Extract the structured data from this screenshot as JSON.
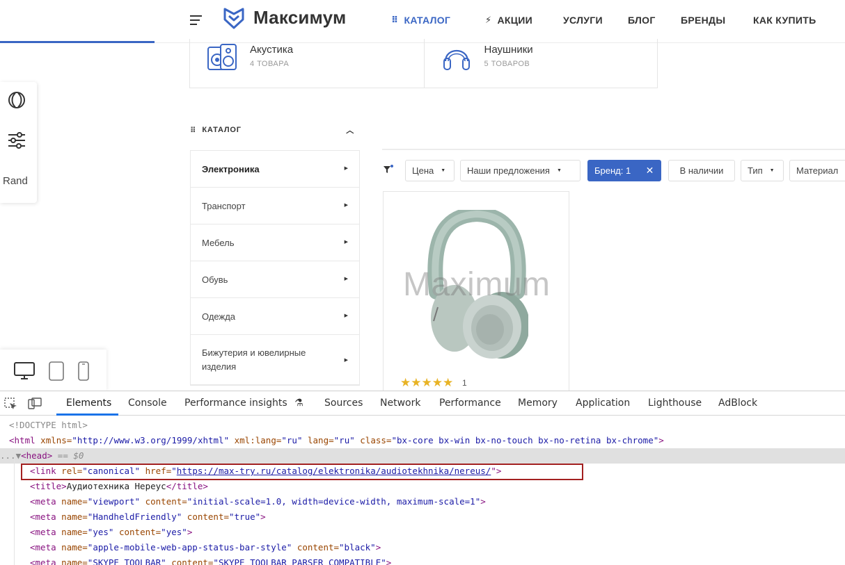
{
  "header": {
    "logo_text": "Максимум",
    "nav": [
      {
        "label": "КАТАЛОГ",
        "icon": "grid-dots-icon",
        "active": true
      },
      {
        "label": "АКЦИИ",
        "icon": "lightning-icon",
        "active": false
      },
      {
        "label": "УСЛУГИ",
        "icon": "",
        "active": false
      },
      {
        "label": "БЛОГ",
        "icon": "",
        "active": false
      },
      {
        "label": "БРЕНДЫ",
        "icon": "",
        "active": false
      },
      {
        "label": "КАК КУПИТЬ",
        "icon": "",
        "active": false
      }
    ],
    "accent_color": "#3a66c4"
  },
  "category_strip": [
    {
      "name": "Акустика",
      "count": "4 ТОВАРА",
      "icon": "speaker-icon"
    },
    {
      "name": "Наушники",
      "count": "5 ТОВАРОВ",
      "icon": "headphones-icon"
    }
  ],
  "float_panel": {
    "label": "Rand"
  },
  "catalog": {
    "heading": "КАТАЛОГ",
    "items": [
      {
        "label": "Электроника",
        "active": true
      },
      {
        "label": "Транспорт",
        "active": false
      },
      {
        "label": "Мебель",
        "active": false
      },
      {
        "label": "Обувь",
        "active": false
      },
      {
        "label": "Одежда",
        "active": false
      },
      {
        "label": "Бижутерия и ювелирные изделия",
        "active": false
      }
    ]
  },
  "filters": {
    "price": "Цена",
    "offers": "Наши предложения",
    "brand": "Бренд: 1",
    "brand_clear": "✕",
    "in_stock": "В наличии",
    "type": "Тип",
    "material": "Материал"
  },
  "product": {
    "watermark": "Maximum",
    "stars": "★★★★★",
    "rating_count": "1"
  },
  "devtools": {
    "tabs": [
      "Elements",
      "Console",
      "Performance insights",
      "Sources",
      "Network",
      "Performance",
      "Memory",
      "Application",
      "Lighthouse",
      "AdBlock"
    ],
    "active_tab": "Elements",
    "code": {
      "doctype": "<!DOCTYPE html>",
      "html_open": "<html",
      "html_xmlns_attr": " xmlns=",
      "html_xmlns_val": "\"http://www.w3.org/1999/xhtml\"",
      "html_xmllang_attr": " xml:lang=",
      "html_xmllang_val": "\"ru\"",
      "html_lang_attr": " lang=",
      "html_lang_val": "\"ru\"",
      "html_class_attr": " class=",
      "html_class_val": "\"bx-core bx-win bx-no-touch bx-no-retina bx-chrome\"",
      "html_close": ">",
      "ellipsis": "...",
      "head_tag": "<head>",
      "head_eq": " == $0",
      "link_open": "<link",
      "link_rel_attr": " rel=",
      "link_rel_val": "\"canonical\"",
      "link_href_attr": " href=",
      "link_href_q": "\"",
      "link_href_val": "https://max-try.ru/catalog/elektronika/audiotekhnika/nereus/",
      "link_close": "\">",
      "title_open": "<title>",
      "title_text": "Аудиотехника Нереус",
      "title_close": "</title>",
      "meta1_attr1": " name=",
      "meta1_val1": "\"viewport\"",
      "meta1_attr2": " content=",
      "meta1_val2": "\"initial-scale=1.0, width=device-width, maximum-scale=1\"",
      "meta2_val1": "\"HandheldFriendly\"",
      "meta2_val2": "\"true\"",
      "meta3_val1": "\"yes\"",
      "meta3_val2": "\"yes\"",
      "meta4_val1": "\"apple-mobile-web-app-status-bar-style\"",
      "meta4_val2": "\"black\"",
      "meta5_val1": "\"SKYPE_TOOLBAR\"",
      "meta5_val2": "\"SKYPE_TOOLBAR_PARSER_COMPATIBLE\"",
      "meta_open": "<meta",
      "tag_close": ">"
    },
    "colors": {
      "tag": "#881280",
      "attr": "#994500",
      "value": "#1a1aa6",
      "highlight": "#a32020"
    }
  }
}
